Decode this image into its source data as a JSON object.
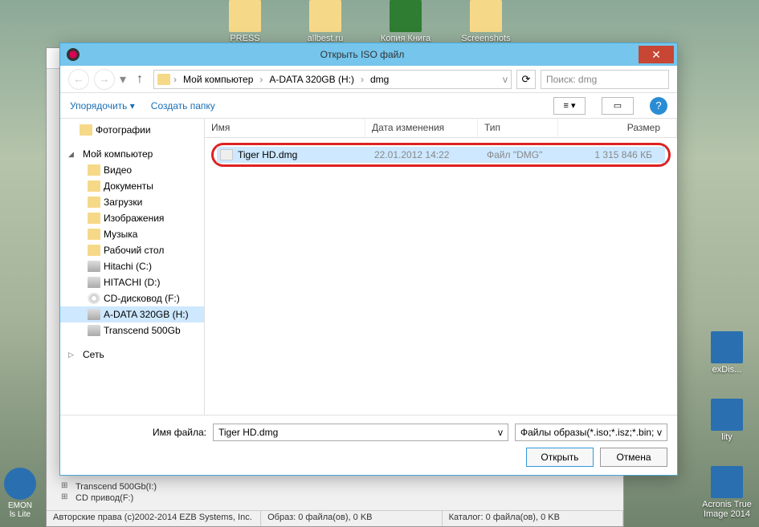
{
  "desktop": {
    "top_icons": [
      {
        "label": "PRESS"
      },
      {
        "label": "allbest.ru"
      },
      {
        "label": "Копия Книга"
      },
      {
        "label": "Screenshots"
      }
    ],
    "left_icon": {
      "label": "EMON\nls Lite"
    },
    "right_icons": [
      {
        "label": "exDis..."
      },
      {
        "label": "lity"
      },
      {
        "label": "Acronis True\nImage 2014"
      }
    ]
  },
  "under_window": {
    "tree": [
      "Transcend 500Gb(I:)",
      "CD привод(F:)"
    ],
    "status": {
      "copyright": "Авторские права (c)2002-2014 EZB Systems, Inc.",
      "image": "Образ: 0 файла(ов), 0 KB",
      "catalog": "Каталог: 0 файла(ов), 0 KB"
    }
  },
  "dialog": {
    "title": "Открыть ISO файл",
    "breadcrumb": [
      "Мой компьютер",
      "A-DATA 320GB (H:)",
      "dmg"
    ],
    "search_placeholder": "Поиск: dmg",
    "toolbar": {
      "organize": "Упорядочить",
      "new_folder": "Создать папку"
    },
    "nav_pane": {
      "photos": "Фотографии",
      "computer": "Мой компьютер",
      "items": [
        {
          "label": "Видео",
          "icon": "folder"
        },
        {
          "label": "Документы",
          "icon": "folder"
        },
        {
          "label": "Загрузки",
          "icon": "folder"
        },
        {
          "label": "Изображения",
          "icon": "folder"
        },
        {
          "label": "Музыка",
          "icon": "folder"
        },
        {
          "label": "Рабочий стол",
          "icon": "folder"
        },
        {
          "label": "Hitachi (C:)",
          "icon": "drive"
        },
        {
          "label": "HITACHI (D:)",
          "icon": "drive"
        },
        {
          "label": "CD-дисковод (F:)",
          "icon": "disc"
        },
        {
          "label": "A-DATA 320GB (H:)",
          "icon": "drive",
          "selected": true
        },
        {
          "label": "Transcend 500Gb",
          "icon": "drive"
        }
      ],
      "network": "Сеть"
    },
    "columns": {
      "name": "Имя",
      "date": "Дата изменения",
      "type": "Тип",
      "size": "Размер"
    },
    "file": {
      "name": "Tiger HD.dmg",
      "date": "22.01.2012 14:22",
      "type": "Файл \"DMG\"",
      "size": "1 315 846 КБ"
    },
    "footer": {
      "filename_label": "Имя файла:",
      "filename_value": "Tiger HD.dmg",
      "filter": "Файлы образы(*.iso;*.isz;*.bin;",
      "open": "Открыть",
      "cancel": "Отмена"
    }
  }
}
